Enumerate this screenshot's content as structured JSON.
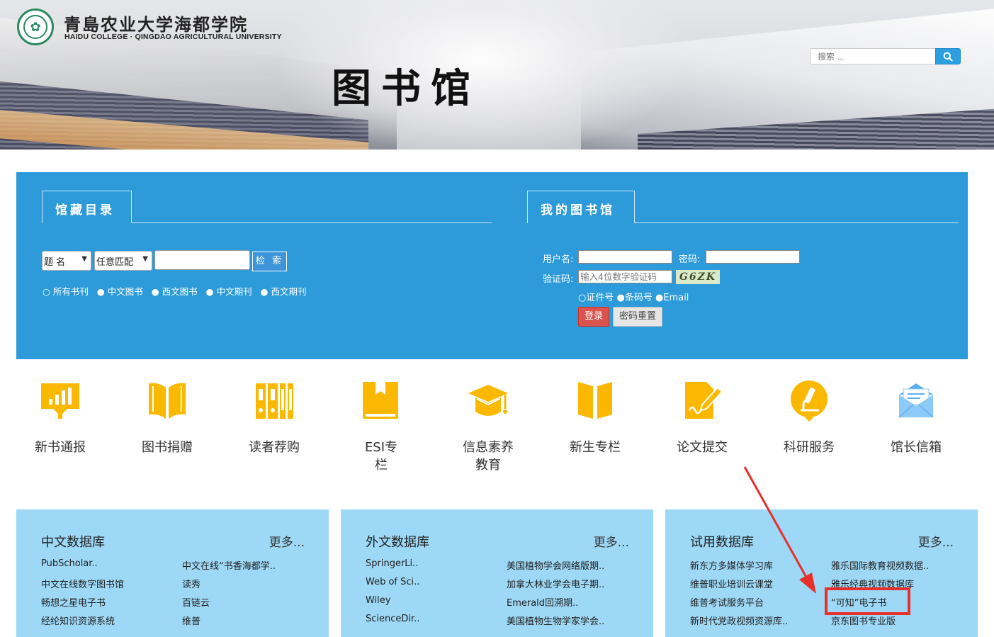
{
  "header": {
    "college_cn": "青島农业大学海都学院",
    "college_en": "HAIDU COLLEGE · QINGDAO AGRICULTURAL UNIVERSITY",
    "page_title": "图书馆",
    "search_placeholder": "搜索 ..."
  },
  "catalog": {
    "tab_label": "馆藏目录",
    "field_select": "题 名",
    "match_select": "任意匹配",
    "search_button": "检 索",
    "scopes": [
      "所有书刊",
      "中文图书",
      "西文图书",
      "中文期刊",
      "西文期刊"
    ]
  },
  "my_library": {
    "tab_label": "我的图书馆",
    "username_label": "用户名:",
    "password_label": "密码:",
    "captcha_label": "验证码:",
    "captcha_placeholder": "输入4位数字验证码",
    "captcha_text": "G6ZK",
    "id_types": [
      "证件号",
      "条码号",
      "Email"
    ],
    "login_button": "登录",
    "reset_button": "密码重置"
  },
  "quick_links": [
    {
      "label": "新书通报",
      "icon": "chart-board-icon"
    },
    {
      "label": "图书捐赠",
      "icon": "open-book-icon"
    },
    {
      "label": "读者荐购",
      "icon": "bookshelf-icon"
    },
    {
      "label": "ESI专栏",
      "icon": "bookmarked-book-icon"
    },
    {
      "label": "信息素养教育",
      "icon": "graduation-cap-icon"
    },
    {
      "label": "新生专栏",
      "icon": "book-icon"
    },
    {
      "label": "论文提交",
      "icon": "document-pen-icon"
    },
    {
      "label": "科研服务",
      "icon": "microscope-icon"
    },
    {
      "label": "馆长信箱",
      "icon": "envelope-icon"
    }
  ],
  "databases": [
    {
      "title": "中文数据库",
      "more": "更多...",
      "left": [
        "PubScholar..",
        "中文在线数字图书馆",
        "畅想之星电子书",
        "经纶知识资源系统"
      ],
      "right": [
        "中文在线“书香海都学..",
        "读秀",
        "百链云",
        "维普"
      ]
    },
    {
      "title": "外文数据库",
      "more": "更多...",
      "left": [
        "SpringerLi..",
        "Web of Sci..",
        "Wiley",
        "ScienceDir.."
      ],
      "right": [
        "美国植物学会网络版期..",
        "加拿大林业学会电子期..",
        "Emerald回溯期..",
        "美国植物生物学家学会.."
      ]
    },
    {
      "title": "试用数据库",
      "more": "更多...",
      "left": [
        "新东方多媒体学习库",
        "维普职业培训云课堂",
        "维普考试服务平台",
        "新时代党政视频资源库.."
      ],
      "right": [
        "雅乐国际教育视频数据..",
        "雅乐经典视频数据库",
        "“可知”电子书",
        "京东图书专业版"
      ]
    }
  ],
  "colors": {
    "panel_blue": "#2d9bd9",
    "db_box": "#9dd8f6",
    "icon_yellow": "#fbb800",
    "login_red": "#d9534f",
    "annotation_red": "#e8302a"
  }
}
